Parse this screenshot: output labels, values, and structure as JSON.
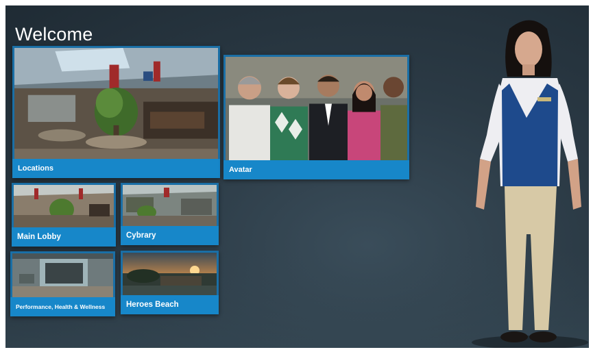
{
  "header": {
    "title": "Welcome"
  },
  "tiles": {
    "locations": {
      "label": "Locations",
      "icon": "lobby-scene-image"
    },
    "avatar": {
      "label": "Avatar",
      "icon": "avatar-group-image"
    },
    "main_lobby": {
      "label": "Main Lobby",
      "icon": "lobby-image"
    },
    "cybrary": {
      "label": "Cybrary",
      "icon": "library-image"
    },
    "performance": {
      "label": "Performance, Health & Wellness",
      "icon": "gym-image"
    },
    "heroes_beach": {
      "label": "Heroes Beach",
      "icon": "beach-sunset-image"
    }
  },
  "guide": {
    "icon": "guide-avatar-figure"
  },
  "colors": {
    "tile_blue": "#1787c9",
    "tile_frame": "#1a6fa6",
    "background": "#2b3a45"
  }
}
